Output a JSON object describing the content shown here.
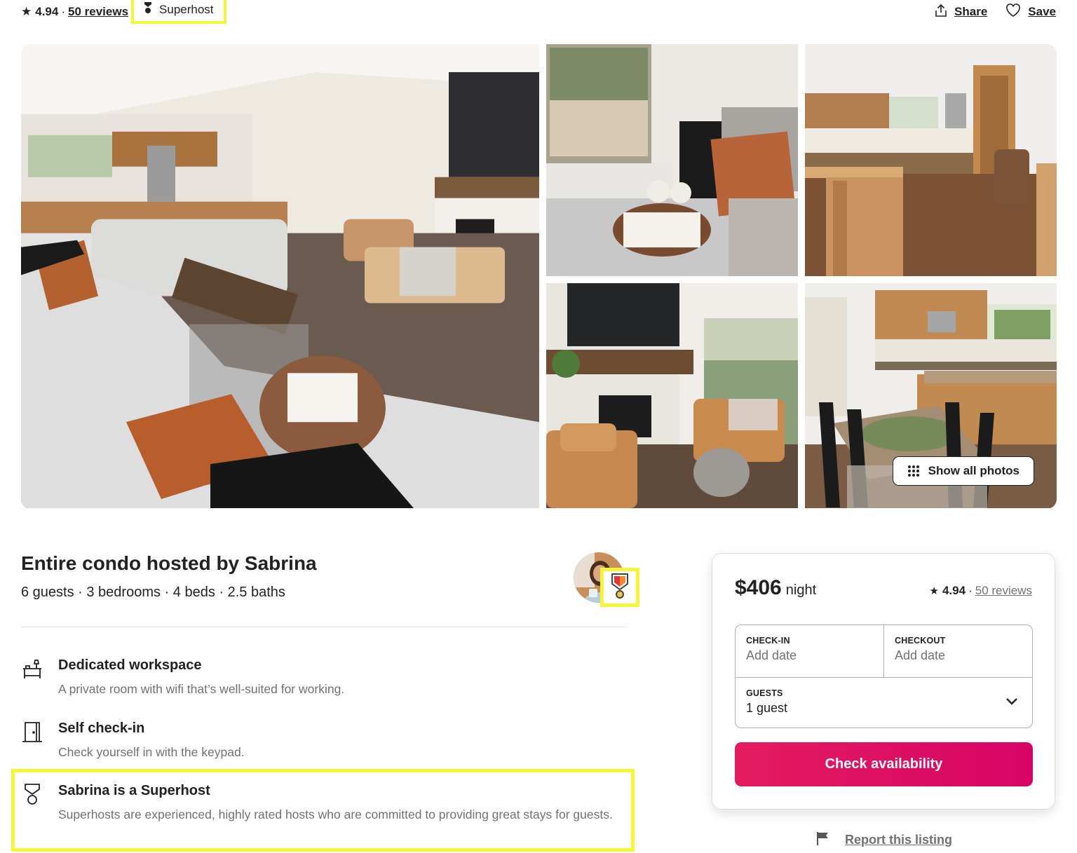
{
  "header": {
    "rating": "4.94",
    "separator": "·",
    "reviews_label": "50 reviews",
    "superhost_label": "Superhost",
    "share_label": "Share",
    "save_label": "Save"
  },
  "gallery": {
    "photos": [
      {
        "alt": "Living room with sectional sofa, fireplace and TV"
      },
      {
        "alt": "Sofa with pillows and tray with mugs and book"
      },
      {
        "alt": "Kitchen and dining with office chair"
      },
      {
        "alt": "Fireplace with leather armchairs"
      },
      {
        "alt": "Dining table and kitchen island"
      }
    ],
    "show_all_label": "Show all photos"
  },
  "listing": {
    "title": "Entire condo hosted by Sabrina",
    "details": "6 guests · 3 bedrooms · 4 beds · 2.5 baths",
    "host_name": "Sabrina"
  },
  "features": [
    {
      "icon": "desk-icon",
      "title": "Dedicated workspace",
      "description": "A private room with wifi that’s well-suited for working."
    },
    {
      "icon": "door-icon",
      "title": "Self check-in",
      "description": "Check yourself in with the keypad."
    },
    {
      "icon": "superhost-medal-icon",
      "title": "Sabrina is a Superhost",
      "description": "Superhosts are experienced, highly rated hosts who are committed to providing great stays for guests."
    }
  ],
  "booking": {
    "price": "$406",
    "per": "night",
    "rating": "4.94",
    "separator": "·",
    "reviews_label": "50 reviews",
    "checkin_label": "CHECK-IN",
    "checkin_placeholder": "Add date",
    "checkout_label": "CHECKOUT",
    "checkout_placeholder": "Add date",
    "guests_label": "GUESTS",
    "guests_value": "1 guest",
    "cta_label": "Check availability",
    "brand_color": "#E31C5F"
  },
  "report": {
    "label": "Report this listing"
  },
  "annotations": {
    "highlight_color": "#F8F43A"
  }
}
